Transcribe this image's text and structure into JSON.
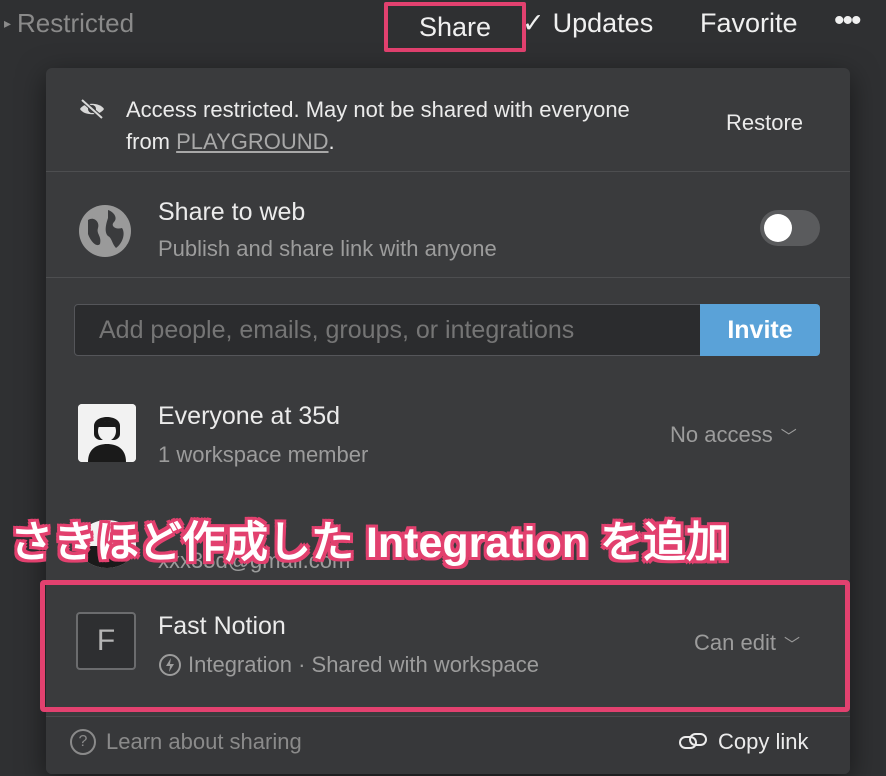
{
  "topbar": {
    "breadcrumb": "Restricted",
    "share_label": "Share",
    "updates_label": "Updates",
    "favorite_label": "Favorite",
    "more_label": "•••"
  },
  "restriction": {
    "message_prefix": "Access restricted. May not be shared with everyone from ",
    "workspace_link": "PLAYGROUND",
    "message_suffix": ".",
    "restore_label": "Restore"
  },
  "share_to_web": {
    "title": "Share to web",
    "subtitle": "Publish and share link with anyone",
    "enabled": false
  },
  "invite": {
    "placeholder": "Add people, emails, groups, or integrations",
    "button_label": "Invite"
  },
  "members": [
    {
      "title": "Everyone at 35d",
      "subtitle": "1 workspace member",
      "access": "No access"
    },
    {
      "title": "",
      "subtitle": "xxx35d@gmail.com",
      "access": ""
    },
    {
      "title": "Fast Notion",
      "avatar_letter": "F",
      "subtitle": "Integration · Shared with workspace",
      "access": "Can edit"
    }
  ],
  "footer": {
    "learn_label": "Learn about sharing",
    "copy_label": "Copy link"
  },
  "annotation": {
    "text": "さきほど作成した Integration を追加"
  },
  "colors": {
    "highlight": "#e2416f",
    "invite_button": "#5aa2d8",
    "popup_bg": "#3a3b3d"
  }
}
